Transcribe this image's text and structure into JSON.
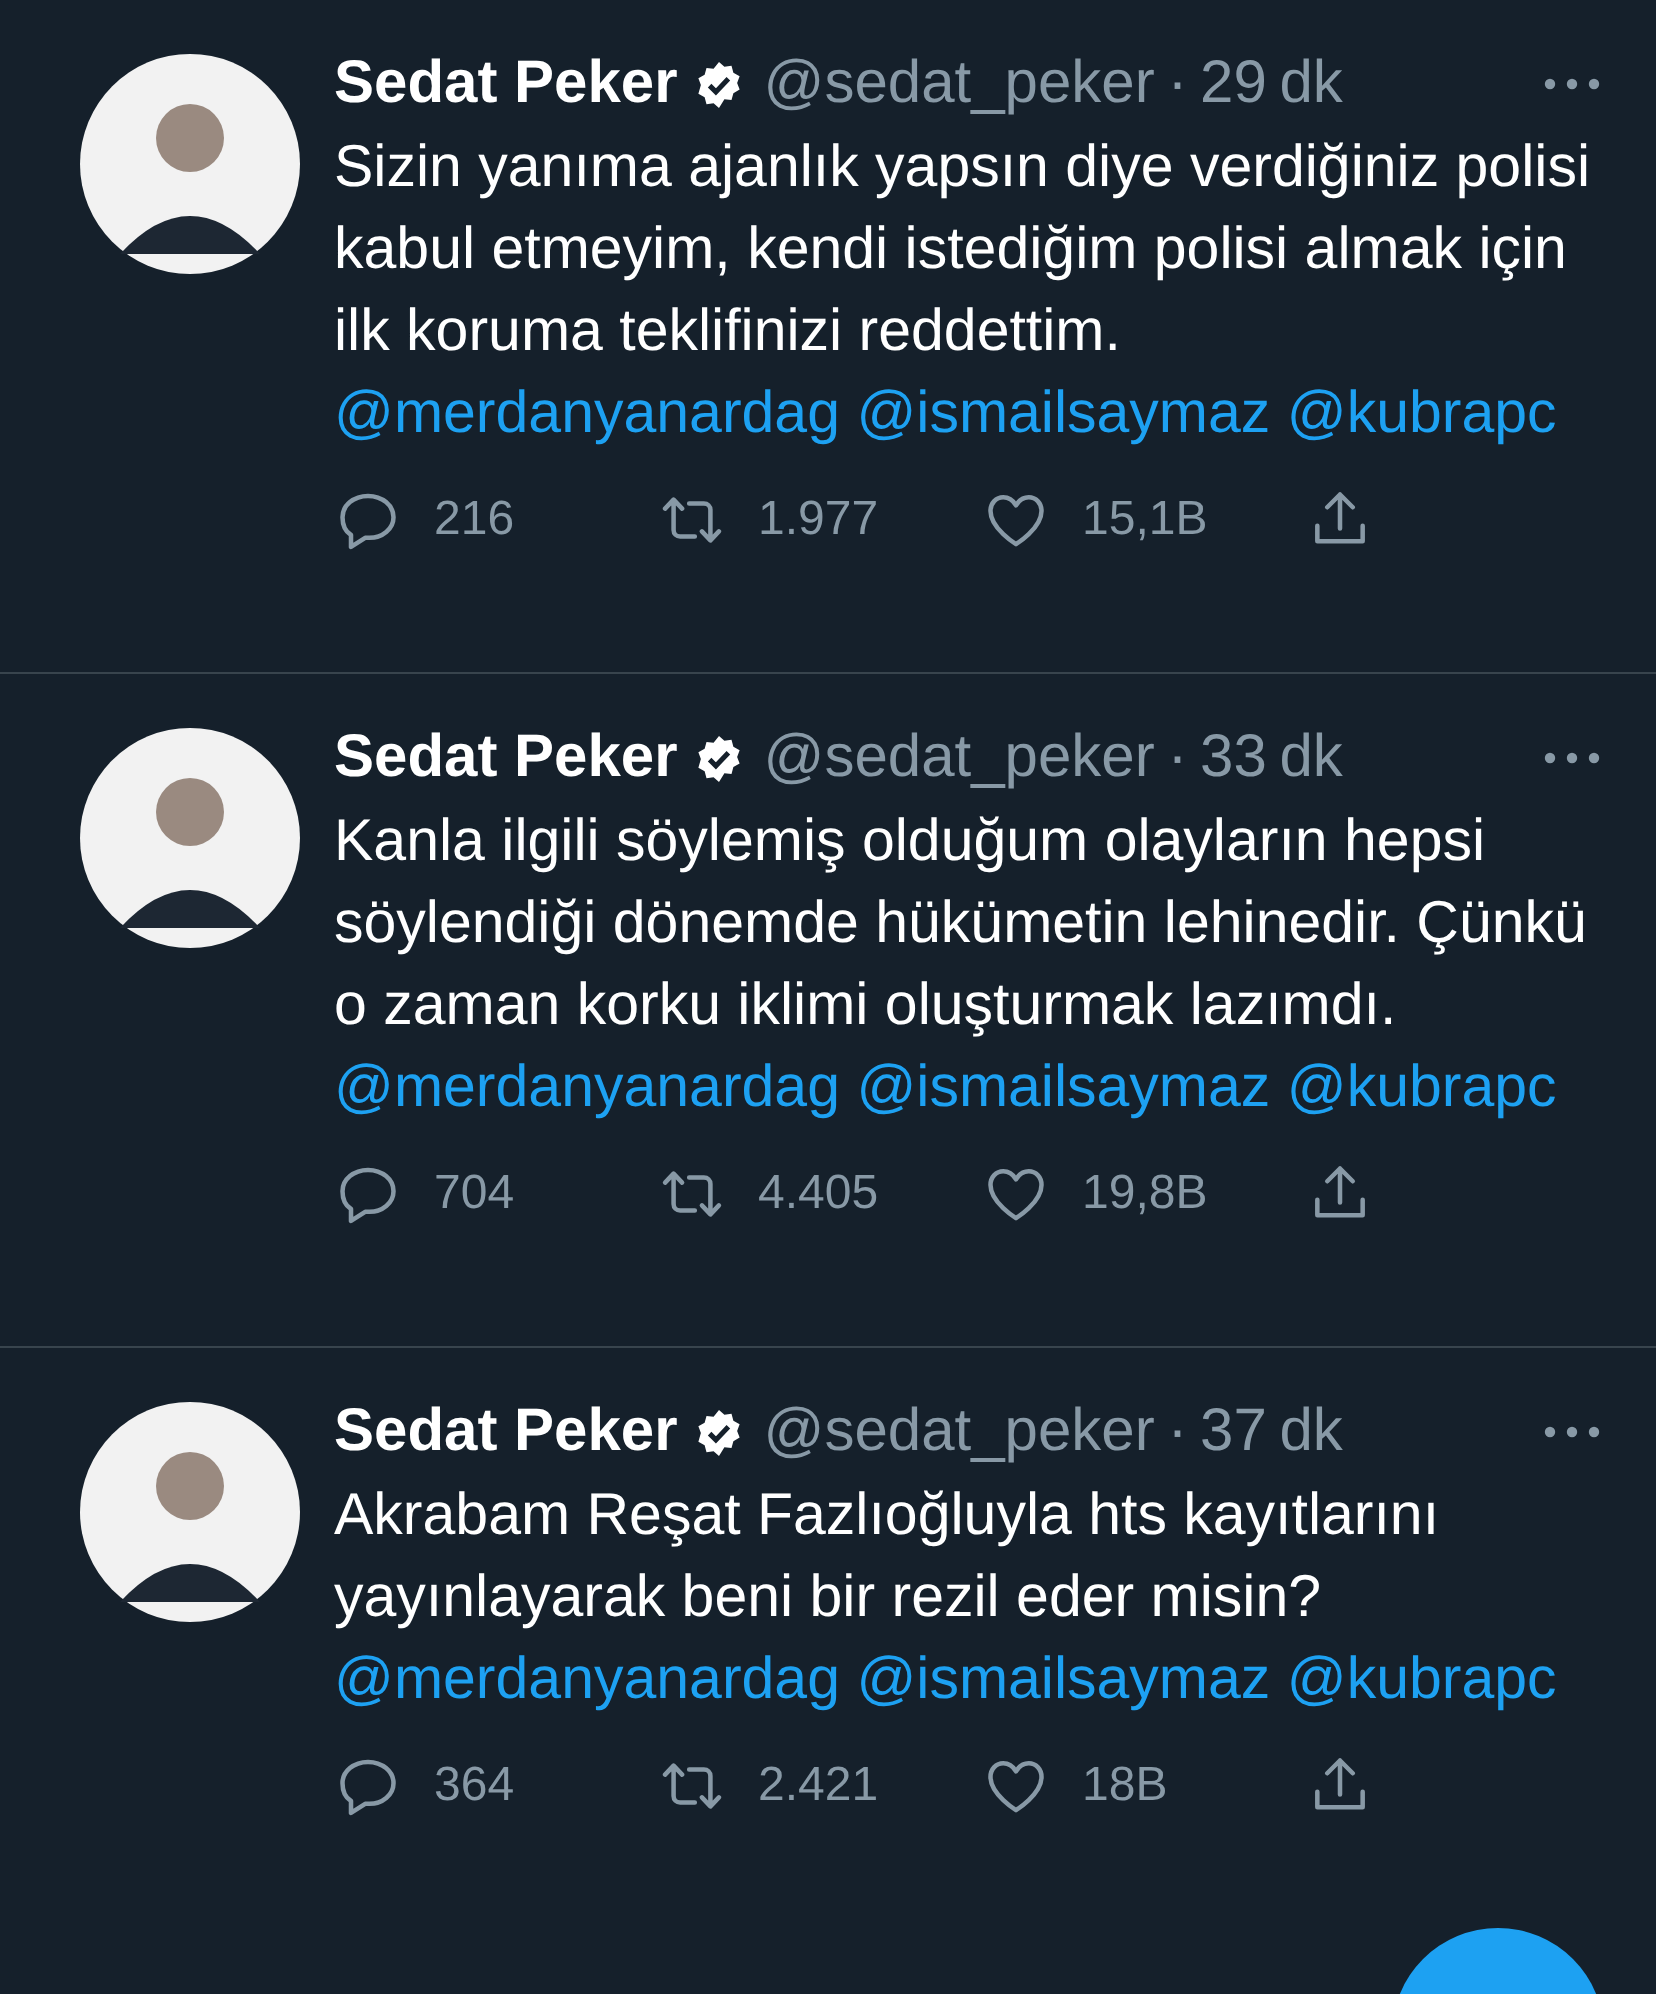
{
  "tweets": [
    {
      "name": "Sedat Peker",
      "verified": true,
      "handle": "@sedat_peker",
      "separator": "·",
      "time": "29 dk",
      "body": [
        {
          "kind": "text",
          "text": "Sizin yanıma ajanlık yapsın diye verdiğiniz polisi kabul etmeyim, kendi istediğim polisi almak için ilk koruma teklifinizi reddettim."
        },
        {
          "kind": "mention",
          "text": "@merdanyanardag"
        },
        {
          "kind": "mention",
          "text": "@ismailsaymaz"
        },
        {
          "kind": "mention",
          "text": "@kubrapc"
        }
      ],
      "replies": "216",
      "retweets": "1.977",
      "likes": "15,1B"
    },
    {
      "name": "Sedat Peker",
      "verified": true,
      "handle": "@sedat_peker",
      "separator": "·",
      "time": "33 dk",
      "body": [
        {
          "kind": "text",
          "text": "Kanla ilgili söylemiş olduğum olayların hepsi söylendiği dönemde hükümetin lehinedir. Çünkü o zaman korku iklimi oluşturmak lazımdı."
        },
        {
          "kind": "mention",
          "text": "@merdanyanardag"
        },
        {
          "kind": "mention",
          "text": "@ismailsaymaz"
        },
        {
          "kind": "mention",
          "text": "@kubrapc"
        }
      ],
      "replies": "704",
      "retweets": "4.405",
      "likes": "19,8B"
    },
    {
      "name": "Sedat Peker",
      "verified": true,
      "handle": "@sedat_peker",
      "separator": "·",
      "time": "37 dk",
      "body": [
        {
          "kind": "text",
          "text": "Akrabam Reşat Fazlıoğluyla hts kayıtlarını yayınlayarak beni bir rezil eder misin?"
        },
        {
          "kind": "mention",
          "text": "@merdanyanardag"
        },
        {
          "kind": "mention",
          "text": "@ismailsaymaz"
        },
        {
          "kind": "mention",
          "text": "@kubrapc"
        }
      ],
      "replies": "364",
      "retweets": "2.421",
      "likes": "18B"
    }
  ]
}
